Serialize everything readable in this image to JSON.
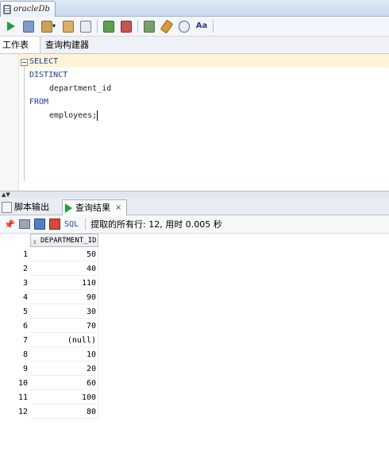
{
  "document_tab": {
    "label": "oracleDb"
  },
  "toolbar": {
    "buttons": [
      "run-statement-icon",
      "run-script-icon",
      "commit-icon",
      "rollback-icon",
      "autotrace-icon",
      "explain-plan-icon",
      "sql-tuning-icon",
      "clear-icon",
      "history-icon",
      "format-icon"
    ]
  },
  "sub_tabs": {
    "worksheet": "工作表",
    "query_builder": "查询构建器"
  },
  "editor": {
    "lines": [
      "SELECT",
      "DISTINCT",
      "department_id",
      "FROM",
      "employees;"
    ]
  },
  "result_tabs": {
    "script_output": "脚本输出",
    "query_result": "查询结果",
    "close": "×"
  },
  "result_toolbar": {
    "sql_label": "SQL",
    "status": "提取的所有行: 12, 用时 0.005 秒"
  },
  "grid": {
    "column_header": "DEPARTMENT_ID",
    "rows": [
      {
        "n": "1",
        "v": "50"
      },
      {
        "n": "2",
        "v": "40"
      },
      {
        "n": "3",
        "v": "110"
      },
      {
        "n": "4",
        "v": "90"
      },
      {
        "n": "5",
        "v": "30"
      },
      {
        "n": "6",
        "v": "70"
      },
      {
        "n": "7",
        "v": "(null)"
      },
      {
        "n": "8",
        "v": "10"
      },
      {
        "n": "9",
        "v": "20"
      },
      {
        "n": "10",
        "v": "60"
      },
      {
        "n": "11",
        "v": "100"
      },
      {
        "n": "12",
        "v": "80"
      }
    ]
  }
}
